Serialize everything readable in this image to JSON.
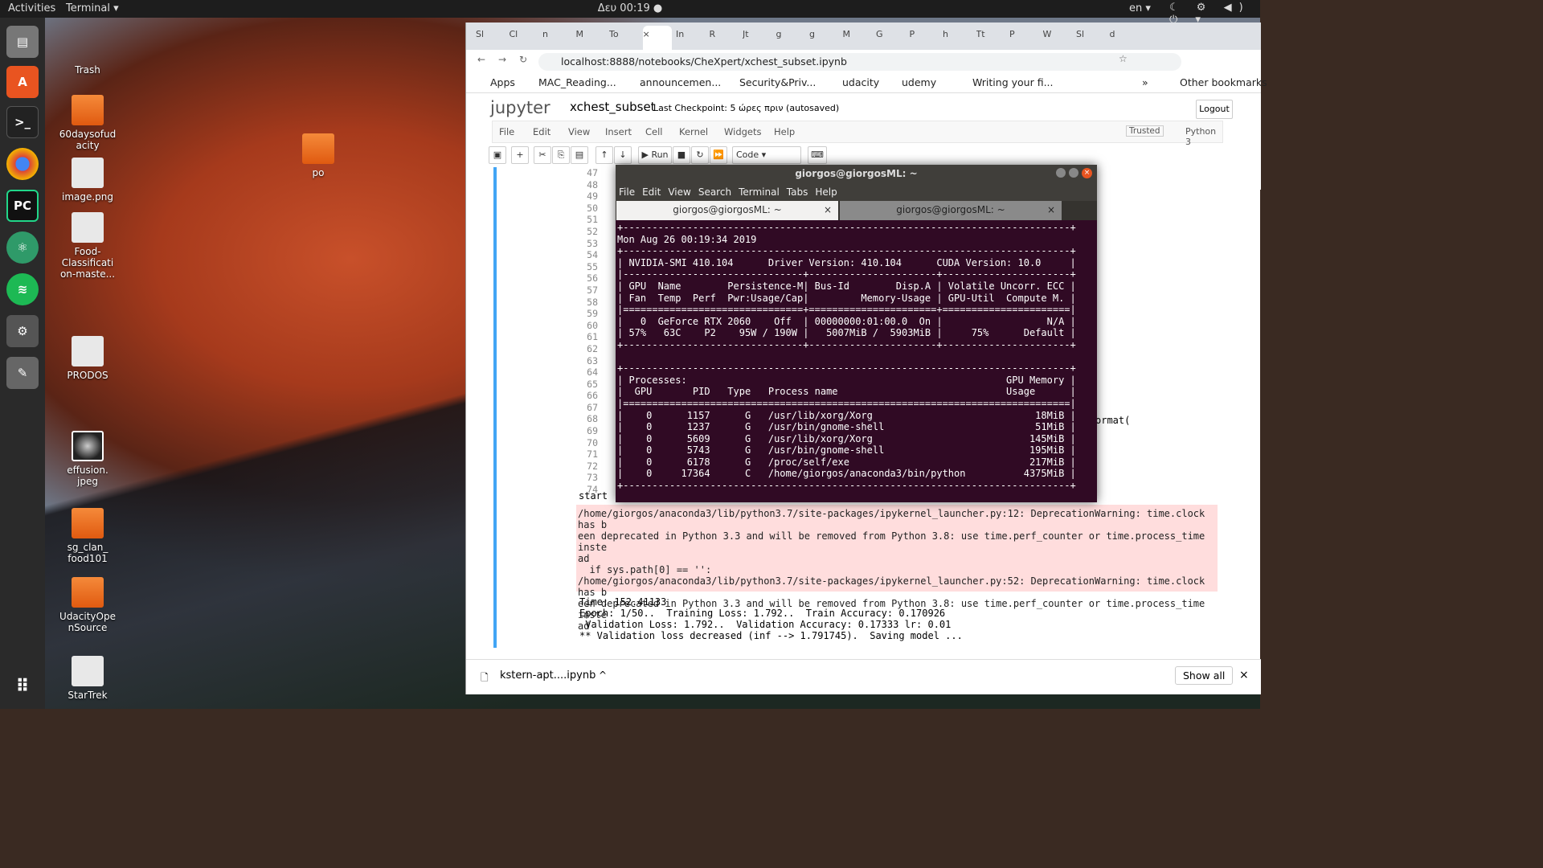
{
  "topbar": {
    "activities": "Activities",
    "app": "Terminal ▾",
    "clock": "Δευ 00:19 ●",
    "lang": "en ▾",
    "tray": "☾ ⚙ ◀) ⏻ ▾"
  },
  "desktop": [
    {
      "label": "Trash",
      "kind": "trash"
    },
    {
      "label": "60daysofud acity",
      "kind": "folder"
    },
    {
      "label": "image.png",
      "kind": "file"
    },
    {
      "label": "Food-Classificati on-maste...",
      "kind": "file"
    },
    {
      "label": "po",
      "kind": "folder"
    },
    {
      "label": "PRODOS",
      "kind": "file"
    },
    {
      "label": "effusion. jpeg",
      "kind": "xr"
    },
    {
      "label": "sg_clan_ food101",
      "kind": "folder"
    },
    {
      "label": "UdacityOpe nSource",
      "kind": "folder"
    },
    {
      "label": "StarTrek",
      "kind": "file"
    }
  ],
  "browser": {
    "tabs": [
      "Sl",
      "Cl",
      "n",
      "M",
      "To",
      "×",
      "In",
      "R",
      "Jt",
      "g",
      "g",
      "M",
      "G",
      "P",
      "h",
      "Tt",
      "P",
      "W",
      "Sl",
      "d"
    ],
    "url": "localhost:8888/notebooks/CheXpert/xchest_subset.ipynb",
    "bookmarks": [
      "Apps",
      "MAC_Reading...",
      "announcemen...",
      "Security&Priv...",
      "udacity",
      "udemy",
      "Writing your fi...",
      "»",
      "Other bookmarks"
    ],
    "jupyter": {
      "logo": "jupyter",
      "name": "xchest_subset",
      "checkpoint": "Last Checkpoint: 5 ώρες πριν  (autosaved)",
      "logout": "Logout",
      "trusted": "Trusted",
      "kernel": "Python 3",
      "menu": [
        "File",
        "Edit",
        "View",
        "Insert",
        "Cell",
        "Kernel",
        "Widgets",
        "Help"
      ],
      "run": "Run",
      "celltype": "Code"
    },
    "line_numbers": [
      "47",
      "48",
      "49",
      "50",
      "51",
      "52",
      "53",
      "54",
      "55",
      "56",
      "57",
      "58",
      "59",
      "60",
      "61",
      "62",
      "63",
      "64",
      "65",
      "66",
      "67",
      "68",
      "69",
      "70",
      "71",
      "72",
      "73",
      "74"
    ],
    "start": "start",
    "code_peek": "ormat(",
    "warning": "/home/giorgos/anaconda3/lib/python3.7/site-packages/ipykernel_launcher.py:12: DeprecationWarning: time.clock has b\neen deprecated in Python 3.3 and will be removed from Python 3.8: use time.perf_counter or time.process_time inste\nad\n  if sys.path[0] == '':\n/home/giorgos/anaconda3/lib/python3.7/site-packages/ipykernel_launcher.py:52: DeprecationWarning: time.clock has b\neen deprecated in Python 3.3 and will be removed from Python 3.8: use time.perf_counter or time.process_time inste\nad",
    "output": "Time: 152.41133\nEpoch: 1/50..  Training Loss: 1.792..  Train Accuracy: 0.170926\n Validation Loss: 1.792..  Validation Accuracy: 0.17333 lr: 0.01\n** Validation loss decreased (inf --> 1.791745).  Saving model ...",
    "download": "kstern-apt....ipynb",
    "showall": "Show all"
  },
  "terminal": {
    "title": "giorgos@giorgosML: ~",
    "menu": [
      "File",
      "Edit",
      "View",
      "Search",
      "Terminal",
      "Tabs",
      "Help"
    ],
    "tabs": [
      "giorgos@giorgosML: ~",
      "giorgos@giorgosML: ~"
    ],
    "body": "+-----------------------------------------------------------------------------+\nMon Aug 26 00:19:34 2019\n+-----------------------------------------------------------------------------+\n| NVIDIA-SMI 410.104      Driver Version: 410.104      CUDA Version: 10.0     |\n|-------------------------------+----------------------+----------------------+\n| GPU  Name        Persistence-M| Bus-Id        Disp.A | Volatile Uncorr. ECC |\n| Fan  Temp  Perf  Pwr:Usage/Cap|         Memory-Usage | GPU-Util  Compute M. |\n|===============================+======================+======================|\n|   0  GeForce RTX 2060    Off  | 00000000:01:00.0  On |                  N/A |\n| 57%   63C    P2    95W / 190W |   5007MiB /  5903MiB |     75%      Default |\n+-------------------------------+----------------------+----------------------+\n\n+-----------------------------------------------------------------------------+\n| Processes:                                                       GPU Memory |\n|  GPU       PID   Type   Process name                             Usage      |\n|=============================================================================|\n|    0      1157      G   /usr/lib/xorg/Xorg                            18MiB |\n|    0      1237      G   /usr/bin/gnome-shell                          51MiB |\n|    0      5609      G   /usr/lib/xorg/Xorg                           145MiB |\n|    0      5743      G   /usr/bin/gnome-shell                         195MiB |\n|    0      6178      G   /proc/self/exe                               217MiB |\n|    0     17364      C   /home/giorgos/anaconda3/bin/python          4375MiB |\n+-----------------------------------------------------------------------------+"
  }
}
